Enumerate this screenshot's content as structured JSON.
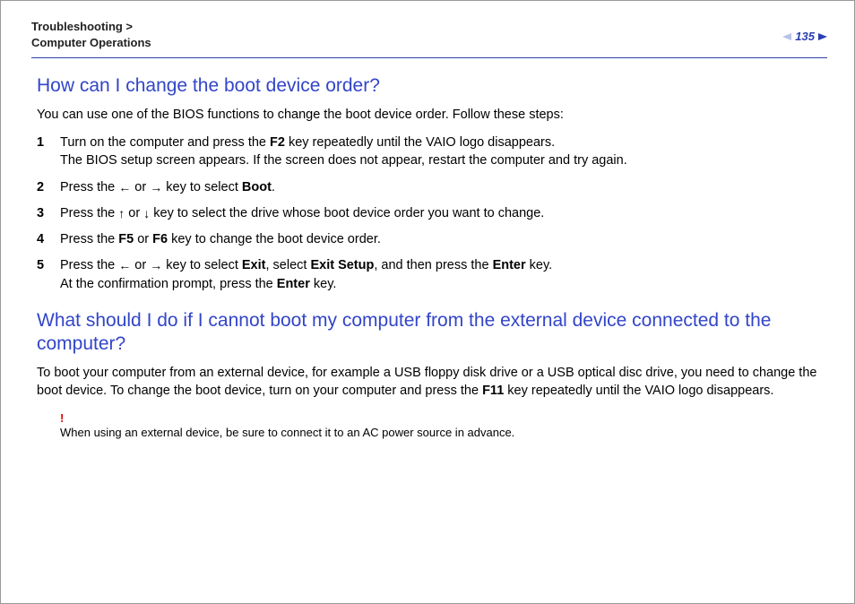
{
  "header": {
    "breadcrumb_line1": "Troubleshooting >",
    "breadcrumb_line2": "Computer Operations",
    "page_number": "135"
  },
  "section1": {
    "title": "How can I change the boot device order?",
    "intro": "You can use one of the BIOS functions to change the boot device order. Follow these steps:",
    "steps": [
      {
        "num": "1",
        "pre": "Turn on the computer and press the ",
        "b1": "F2",
        "mid1": " key repeatedly until the VAIO logo disappears.",
        "line2": "The BIOS setup screen appears. If the screen does not appear, restart the computer and try again."
      },
      {
        "num": "2",
        "pre": "Press the ",
        "arrow1": "←",
        "or": " or ",
        "arrow2": "→",
        "mid": " key to select ",
        "b1": "Boot",
        "tail": "."
      },
      {
        "num": "3",
        "pre": "Press the ",
        "arrow1": "↑",
        "or": " or ",
        "arrow2": "↓",
        "tail": " key to select the drive whose boot device order you want to change."
      },
      {
        "num": "4",
        "pre": "Press the ",
        "b1": "F5",
        "or": " or ",
        "b2": "F6",
        "tail": " key to change the boot device order."
      },
      {
        "num": "5",
        "pre": "Press the ",
        "arrow1": "←",
        "or": " or ",
        "arrow2": "→",
        "mid1": " key to select ",
        "b1": "Exit",
        "mid2": ", select ",
        "b2": "Exit Setup",
        "mid3": ", and then press the ",
        "b3": "Enter",
        "tail": " key.",
        "line2a": "At the confirmation prompt, press the ",
        "line2b": "Enter",
        "line2c": " key."
      }
    ]
  },
  "section2": {
    "title": "What should I do if I cannot boot my computer from the external device connected to the computer?",
    "body_pre": "To boot your computer from an external device, for example a USB floppy disk drive or a USB optical disc drive, you need to change the boot device. To change the boot device, turn on your computer and press the ",
    "body_b1": "F11",
    "body_post": " key repeatedly until the VAIO logo disappears.",
    "note_mark": "!",
    "note_text": "When using an external device, be sure to connect it to an AC power source in advance."
  }
}
